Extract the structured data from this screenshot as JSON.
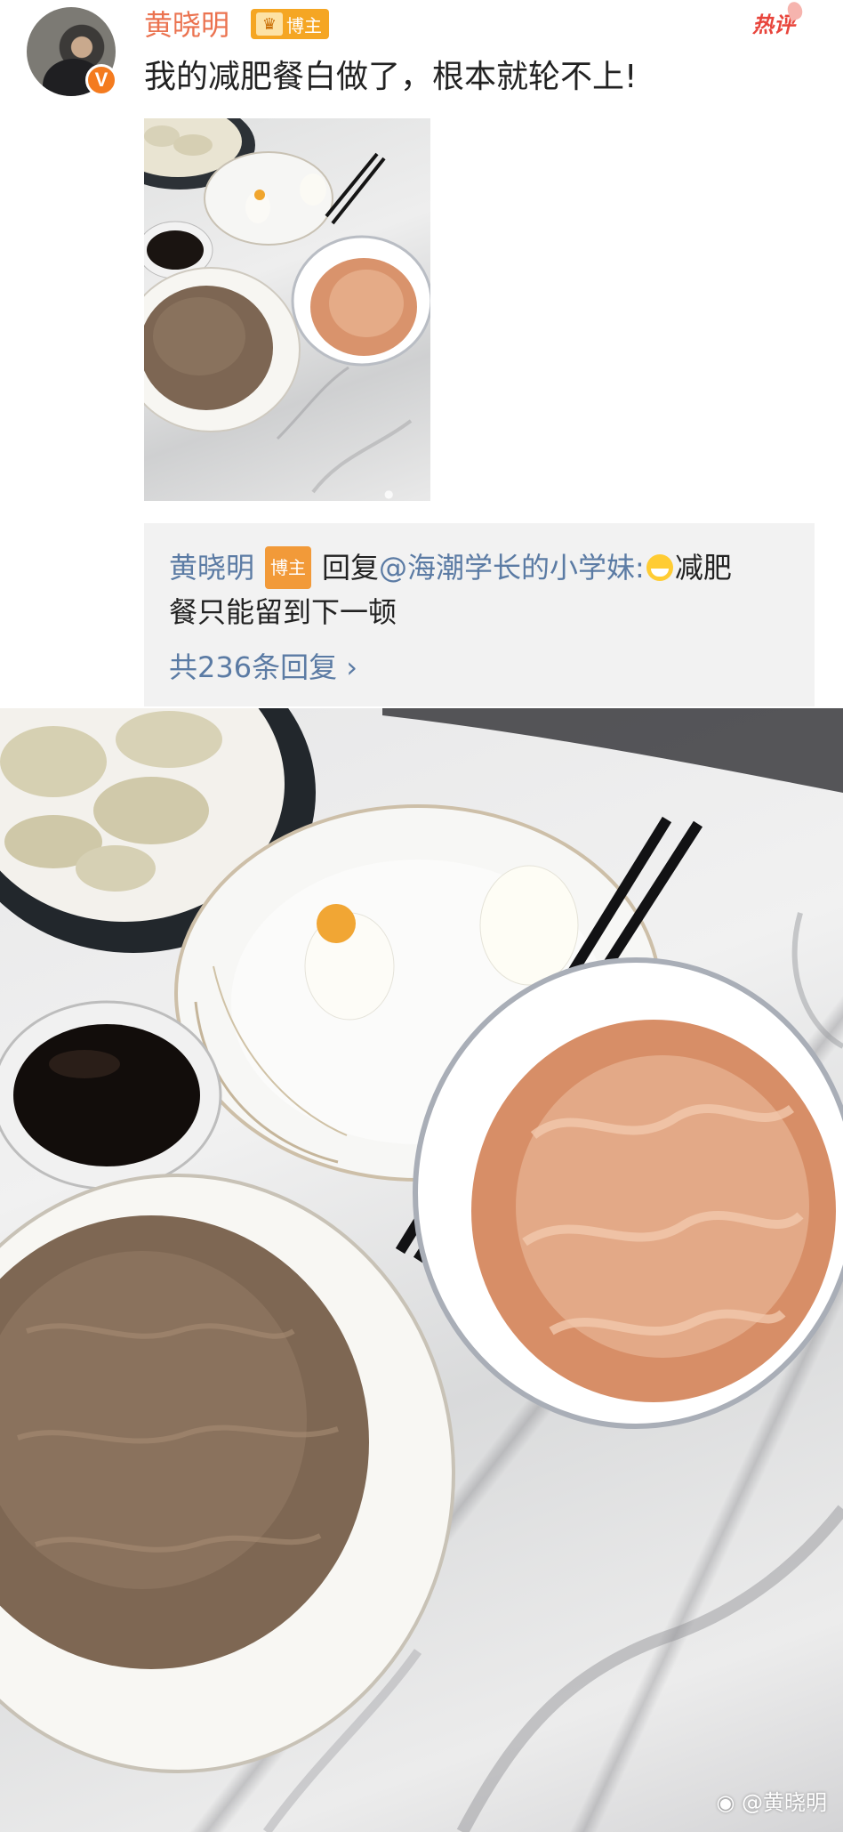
{
  "post": {
    "username": "黄晓明",
    "tag": "博主",
    "hot_label": "热评",
    "text": "我的减肥餐白做了，根本就轮不上!",
    "avatar_badge": "V"
  },
  "reply": {
    "name": "黄晓明",
    "tag": "博主",
    "prefix": "回复",
    "mention": "@海潮学长的小学妹:",
    "text_line1": "减肥",
    "text_line2": "餐只能留到下一顿",
    "count_label": "共236条回复 ›"
  },
  "photo_watermark": "@黄晓明",
  "icons": {
    "verified": "verified-badge-icon",
    "crown": "crown-icon",
    "emoji": "laugh-cry-emoji-icon",
    "weibo": "weibo-logo-icon"
  },
  "colors": {
    "username": "#eb7350",
    "link": "#5b7ba4",
    "tag": "#f5a623",
    "hot": "#e8453c",
    "reply_bg": "#f2f2f2"
  }
}
